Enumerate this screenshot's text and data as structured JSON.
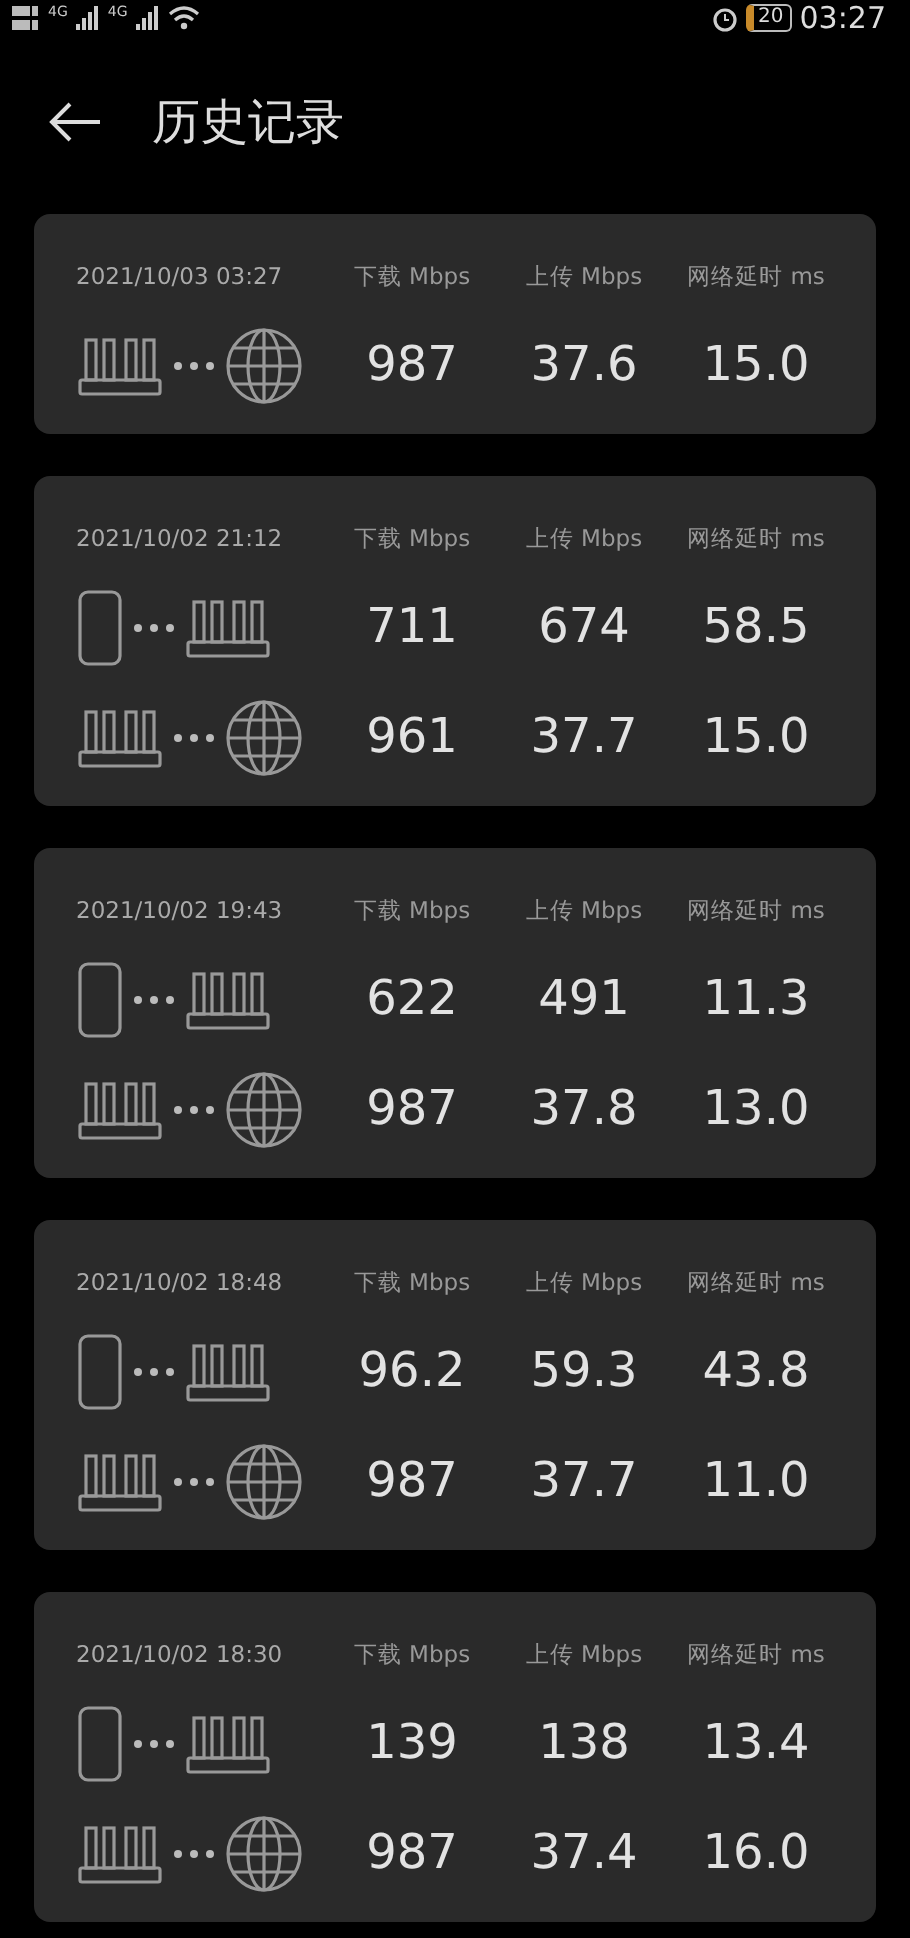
{
  "status_bar": {
    "signals": [
      "4G",
      "4G"
    ],
    "battery": "20",
    "time": "03:27"
  },
  "header": {
    "title": "历史记录"
  },
  "records": [
    {
      "date": "2021/10/03 03:27",
      "columns": [
        "下载 Mbps",
        "上传 Mbps",
        "网络延时 ms"
      ],
      "rows": [
        {
          "kind": "router-internet",
          "values": [
            "987",
            "37.6",
            "15.0"
          ]
        }
      ]
    },
    {
      "date": "2021/10/02 21:12",
      "columns": [
        "下载 Mbps",
        "上传 Mbps",
        "网络延时 ms"
      ],
      "rows": [
        {
          "kind": "phone-router",
          "values": [
            "711",
            "674",
            "58.5"
          ]
        },
        {
          "kind": "router-internet",
          "values": [
            "961",
            "37.7",
            "15.0"
          ]
        }
      ]
    },
    {
      "date": "2021/10/02 19:43",
      "columns": [
        "下载 Mbps",
        "上传 Mbps",
        "网络延时 ms"
      ],
      "rows": [
        {
          "kind": "phone-router",
          "values": [
            "622",
            "491",
            "11.3"
          ]
        },
        {
          "kind": "router-internet",
          "values": [
            "987",
            "37.8",
            "13.0"
          ]
        }
      ]
    },
    {
      "date": "2021/10/02 18:48",
      "columns": [
        "下载 Mbps",
        "上传 Mbps",
        "网络延时 ms"
      ],
      "rows": [
        {
          "kind": "phone-router",
          "values": [
            "96.2",
            "59.3",
            "43.8"
          ]
        },
        {
          "kind": "router-internet",
          "values": [
            "987",
            "37.7",
            "11.0"
          ]
        }
      ]
    },
    {
      "date": "2021/10/02 18:30",
      "columns": [
        "下载 Mbps",
        "上传 Mbps",
        "网络延时 ms"
      ],
      "rows": [
        {
          "kind": "phone-router",
          "values": [
            "139",
            "138",
            "13.4"
          ]
        },
        {
          "kind": "router-internet",
          "values": [
            "987",
            "37.4",
            "16.0"
          ]
        }
      ]
    }
  ]
}
